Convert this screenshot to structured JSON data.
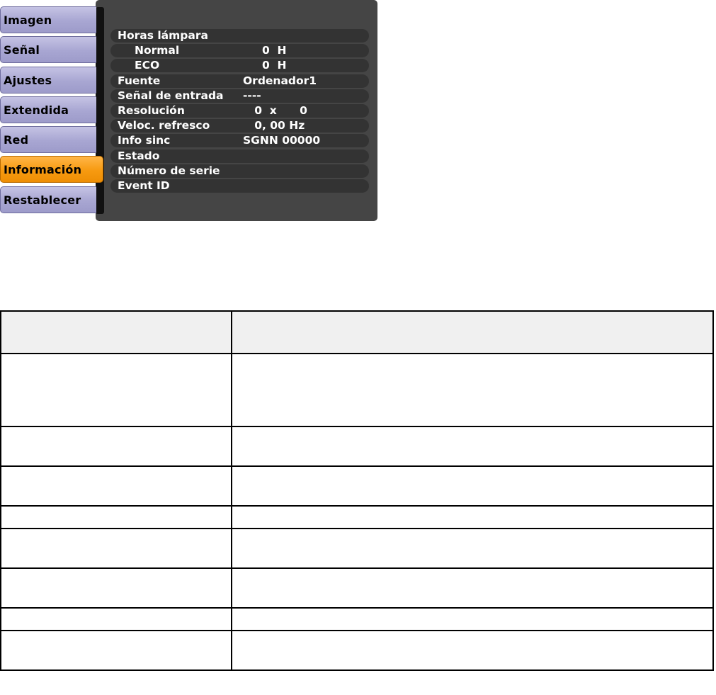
{
  "menu": {
    "tabs": [
      {
        "label": "Imagen",
        "active": false
      },
      {
        "label": "Señal",
        "active": false
      },
      {
        "label": "Ajustes",
        "active": false
      },
      {
        "label": "Extendida",
        "active": false
      },
      {
        "label": "Red",
        "active": false
      },
      {
        "label": "Información",
        "active": true
      },
      {
        "label": "Restablecer",
        "active": false
      }
    ],
    "rows": [
      {
        "label": "Horas lámpara",
        "value": ""
      },
      {
        "label": "Normal",
        "value": "     0  H"
      },
      {
        "label": "ECO",
        "value": "     0  H"
      },
      {
        "label": "Fuente",
        "value": "Ordenador1"
      },
      {
        "label": "Señal de entrada",
        "value": "----"
      },
      {
        "label": "Resolución",
        "value": "   0  x      0"
      },
      {
        "label": "Veloc. refresco",
        "value": "   0, 00 Hz"
      },
      {
        "label": "Info sinc",
        "value": "SGNN 00000"
      },
      {
        "label": "Estado",
        "value": ""
      },
      {
        "label": "Número de serie",
        "value": ""
      },
      {
        "label": "Event ID",
        "value": ""
      }
    ]
  },
  "colors": {
    "tab_inactive": "#a8a6d2",
    "tab_active": "#f79a10",
    "panel_bg": "#454545",
    "row_bg": "#333333",
    "table_header_bg": "#f0f0f0"
  },
  "table": {
    "headers": [
      "",
      ""
    ],
    "rows": [
      [
        "",
        ""
      ],
      [
        "",
        ""
      ],
      [
        "",
        ""
      ],
      [
        "",
        ""
      ],
      [
        "",
        ""
      ],
      [
        "",
        ""
      ],
      [
        "",
        ""
      ],
      [
        "",
        ""
      ]
    ]
  }
}
